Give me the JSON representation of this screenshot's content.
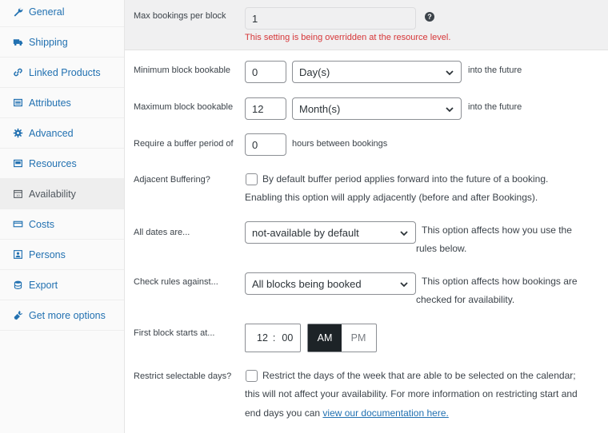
{
  "sidebar": {
    "items": [
      {
        "label": "General",
        "icon": "wrench-icon"
      },
      {
        "label": "Shipping",
        "icon": "truck-icon"
      },
      {
        "label": "Linked Products",
        "icon": "link-icon"
      },
      {
        "label": "Attributes",
        "icon": "list-icon"
      },
      {
        "label": "Advanced",
        "icon": "gear-icon"
      },
      {
        "label": "Resources",
        "icon": "resource-icon"
      },
      {
        "label": "Availability",
        "icon": "calendar-icon"
      },
      {
        "label": "Costs",
        "icon": "card-icon"
      },
      {
        "label": "Persons",
        "icon": "person-icon"
      },
      {
        "label": "Export",
        "icon": "database-icon"
      },
      {
        "label": "Get more options",
        "icon": "plugin-icon"
      }
    ],
    "active_item": "Availability"
  },
  "form": {
    "max_bookings": {
      "label": "Max bookings per block",
      "value": "1",
      "warning": "This setting is being overridden at the resource level."
    },
    "min_block": {
      "label": "Minimum block bookable",
      "value": "0",
      "unit": "Day(s)",
      "after": "into the future"
    },
    "max_block": {
      "label": "Maximum block bookable",
      "value": "12",
      "unit": "Month(s)",
      "after": "into the future"
    },
    "buffer": {
      "label": "Require a buffer period of",
      "value": "0",
      "after": "hours between bookings"
    },
    "adjacent": {
      "label": "Adjacent Buffering?",
      "line1": "By default buffer period applies forward into the future of a booking.",
      "line2": "Enabling this option will apply adjacently (before and after Bookings)."
    },
    "all_dates": {
      "label": "All dates are...",
      "value": "not-available by default",
      "desc1": "This option affects how you use the",
      "desc2": "rules below."
    },
    "check_rules": {
      "label": "Check rules against...",
      "value": "All blocks being booked",
      "desc1": "This option affects how bookings are",
      "desc2": "checked for availability."
    },
    "first_block": {
      "label": "First block starts at...",
      "hour": "12",
      "sep": ":",
      "minute": "00",
      "am": "AM",
      "pm": "PM",
      "selected": "AM"
    },
    "restrict": {
      "label": "Restrict selectable days?",
      "line1": "Restrict the days of the week that are able to be selected on the calendar;",
      "line2": "this will not affect your availability. For more information on restricting start and",
      "line3_prefix": "end days you can ",
      "link": "view our documentation here."
    }
  },
  "colors": {
    "link": "#2271b1",
    "warning": "#d63638",
    "selected_toggle": "#1d2327"
  }
}
